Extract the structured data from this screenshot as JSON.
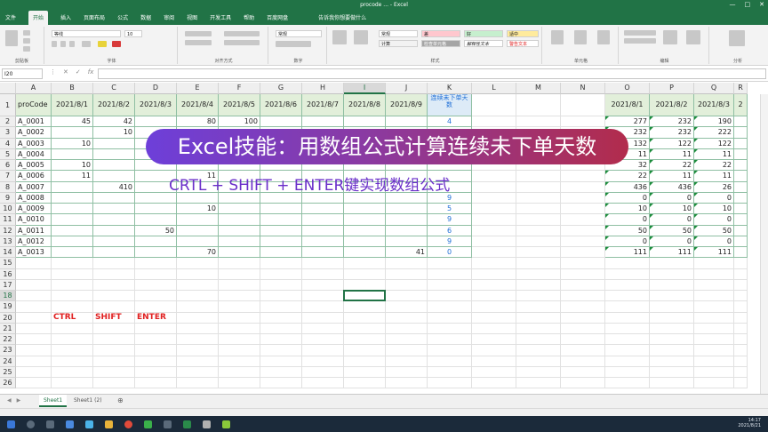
{
  "window": {
    "title": "procode ... - Excel",
    "controls": [
      "—",
      "□",
      "✕"
    ]
  },
  "ribbon_tabs": [
    "文件",
    "开始",
    "插入",
    "页面布局",
    "公式",
    "数据",
    "审阅",
    "视图",
    "开发工具",
    "帮助",
    "百度网盘",
    "告诉我你想要做什么"
  ],
  "ribbon": {
    "groups": [
      "剪贴板",
      "字体",
      "对齐方式",
      "数字",
      "样式",
      "单元格",
      "编辑",
      "分析"
    ],
    "font_name": "等线",
    "font_size": "10",
    "number_format": "常规",
    "styles": [
      "常规",
      "差",
      "好",
      "适中",
      "计算",
      "检查单元格",
      "解释性文本",
      "警告文本"
    ]
  },
  "formula_bar": {
    "name_box": "I20",
    "value": ""
  },
  "columns": [
    "A",
    "B",
    "C",
    "D",
    "E",
    "F",
    "G",
    "H",
    "I",
    "J",
    "K",
    "L",
    "M",
    "N",
    "O",
    "P",
    "Q",
    "R"
  ],
  "rows": [
    "1",
    "2",
    "3",
    "4",
    "5",
    "6",
    "7",
    "8",
    "9",
    "10",
    "11",
    "12",
    "13",
    "14",
    "15",
    "16",
    "17",
    "18",
    "19",
    "20",
    "21",
    "22",
    "23",
    "24",
    "25",
    "26"
  ],
  "table": {
    "headers": [
      "proCode",
      "2021/8/1",
      "2021/8/2",
      "2021/8/3",
      "2021/8/4",
      "2021/8/5",
      "2021/8/6",
      "2021/8/7",
      "2021/8/8",
      "2021/8/9",
      "连续未下单天数"
    ],
    "rows": [
      [
        "A_0001",
        "45",
        "42",
        "",
        "80",
        "100",
        "",
        "",
        "",
        "",
        "4"
      ],
      [
        "A_0002",
        "",
        "10",
        "",
        "",
        "",
        "",
        "",
        "",
        "",
        ""
      ],
      [
        "A_0003",
        "10",
        "",
        "",
        "",
        "",
        "",
        "",
        "",
        "",
        ""
      ],
      [
        "A_0004",
        "",
        "",
        "",
        "",
        "",
        "",
        "",
        "",
        "",
        ""
      ],
      [
        "A_0005",
        "10",
        "",
        "",
        "",
        "",
        "",
        "",
        "",
        "",
        ""
      ],
      [
        "A_0006",
        "11",
        "",
        "",
        "11",
        "",
        "",
        "",
        "",
        "",
        ""
      ],
      [
        "A_0007",
        "",
        "410",
        "",
        "",
        "",
        "",
        "",
        "",
        "",
        ""
      ],
      [
        "A_0008",
        "",
        "",
        "",
        "",
        "",
        "",
        "",
        "",
        "",
        "9"
      ],
      [
        "A_0009",
        "",
        "",
        "",
        "10",
        "",
        "",
        "",
        "",
        "",
        "5"
      ],
      [
        "A_0010",
        "",
        "",
        "",
        "",
        "",
        "",
        "",
        "",
        "",
        "9"
      ],
      [
        "A_0011",
        "",
        "",
        "50",
        "",
        "",
        "",
        "",
        "",
        "",
        "6"
      ],
      [
        "A_0012",
        "",
        "",
        "",
        "",
        "",
        "",
        "",
        "",
        "",
        "9"
      ],
      [
        "A_0013",
        "",
        "",
        "",
        "70",
        "",
        "",
        "",
        "",
        "41",
        "0"
      ]
    ]
  },
  "right_table": {
    "headers": [
      "2021/8/1",
      "2021/8/2",
      "2021/8/3",
      "2"
    ],
    "rows": [
      [
        "277",
        "232",
        "190",
        ""
      ],
      [
        "232",
        "232",
        "222",
        ""
      ],
      [
        "132",
        "122",
        "122",
        ""
      ],
      [
        "11",
        "11",
        "11",
        ""
      ],
      [
        "32",
        "22",
        "22",
        ""
      ],
      [
        "22",
        "11",
        "11",
        ""
      ],
      [
        "436",
        "436",
        "26",
        ""
      ],
      [
        "0",
        "0",
        "0",
        ""
      ],
      [
        "10",
        "10",
        "10",
        ""
      ],
      [
        "0",
        "0",
        "0",
        ""
      ],
      [
        "50",
        "50",
        "50",
        ""
      ],
      [
        "0",
        "0",
        "0",
        ""
      ],
      [
        "111",
        "111",
        "111",
        ""
      ]
    ]
  },
  "keys_row": [
    "CTRL",
    "SHIFT",
    "ENTER"
  ],
  "overlay": {
    "title": "Excel技能：用数组公式计算连续未下单天数",
    "subtitle": "CRTL + SHIFT + ENTER键实现数组公式"
  },
  "sheets": [
    {
      "label": "Sheet1",
      "active": true
    },
    {
      "label": "Sheet1 (2)",
      "active": false
    }
  ],
  "add_sheet": "⊕",
  "clock": {
    "time": "14:17",
    "date": "2021/8/21"
  },
  "colors": {
    "excel_green": "#217346",
    "table_header": "#e2efda",
    "k_blue": "#1f6fd6",
    "red": "#e02020",
    "banner_start": "#6d3fd9",
    "banner_end": "#b22c4c"
  }
}
